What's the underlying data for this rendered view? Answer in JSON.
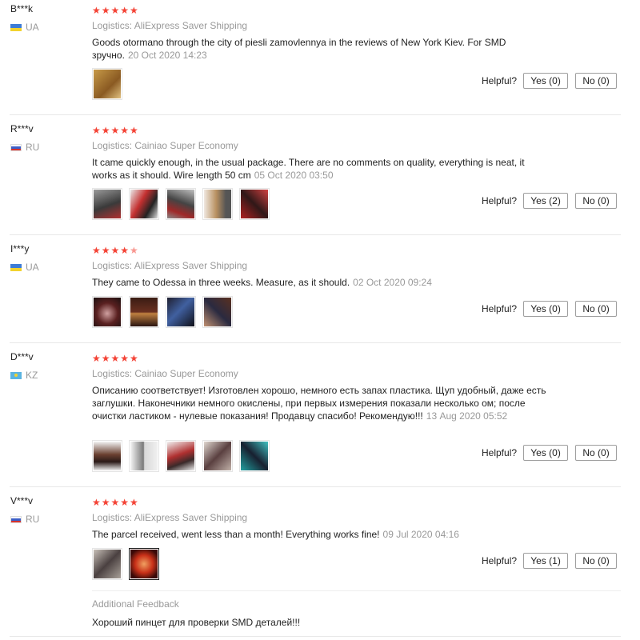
{
  "reviews": [
    {
      "user": "B***k",
      "country": "UA",
      "stars": "★★★★★",
      "logistics": "Logistics: AliExpress Saver Shipping",
      "text": "Goods otormano through the city of piesli zamovlennya in the reviews of New York Kiev. For SMD зручно.",
      "date": "20 Oct 2020 14:23",
      "helpful_label": "Helpful?",
      "yes": "Yes (0)",
      "no": "No (0)",
      "photo_count": 1
    },
    {
      "user": "R***v",
      "country": "RU",
      "stars": "★★★★★",
      "logistics": "Logistics: Cainiao Super Economy",
      "text": "It came quickly enough, in the usual package. There are no comments on quality, everything is neat, it works as it should. Wire length 50 cm",
      "date": "05 Oct 2020 03:50",
      "helpful_label": "Helpful?",
      "yes": "Yes (2)",
      "no": "No (0)",
      "photo_count": 5
    },
    {
      "user": "I***y",
      "country": "UA",
      "stars": "★★★★",
      "stars_half": "★",
      "logistics": "Logistics: AliExpress Saver Shipping",
      "text": "They came to Odessa in three weeks. Measure, as it should.",
      "date": "02 Oct 2020 09:24",
      "helpful_label": "Helpful?",
      "yes": "Yes (0)",
      "no": "No (0)",
      "photo_count": 4
    },
    {
      "user": "D***v",
      "country": "KZ",
      "stars": "★★★★★",
      "logistics": "Logistics: Cainiao Super Economy",
      "text": "Описанию соответствует! Изготовлен хорошо, немного есть запах пластика. Щуп удобный, даже есть заглушки. Наконечники немного окислены, при первых измерения показали несколько ом; после очистки ластиком - нулевые показания! Продавцу спасибо! Рекомендую!!!",
      "date": "13 Aug 2020 05:52",
      "helpful_label": "Helpful?",
      "yes": "Yes (0)",
      "no": "No (0)",
      "photo_count": 5
    },
    {
      "user": "V***v",
      "country": "RU",
      "stars": "★★★★★",
      "logistics": "Logistics: AliExpress Saver Shipping",
      "text": "The parcel received, went less than a month! Everything works fine!",
      "date": "09 Jul 2020 04:16",
      "helpful_label": "Helpful?",
      "yes": "Yes (1)",
      "no": "No (0)",
      "photo_count": 2,
      "additional_feedback_title": "Additional Feedback",
      "additional_feedback_text": "Хороший пинцет для проверки SMD деталей!!!"
    }
  ],
  "flag_colors": {
    "UA": [
      "#3d7cd6",
      "#f2d22e"
    ],
    "RU": [
      "#ffffff",
      "#3b5fc8",
      "#d6322d"
    ],
    "KZ": [
      "#5ab4e0"
    ]
  }
}
